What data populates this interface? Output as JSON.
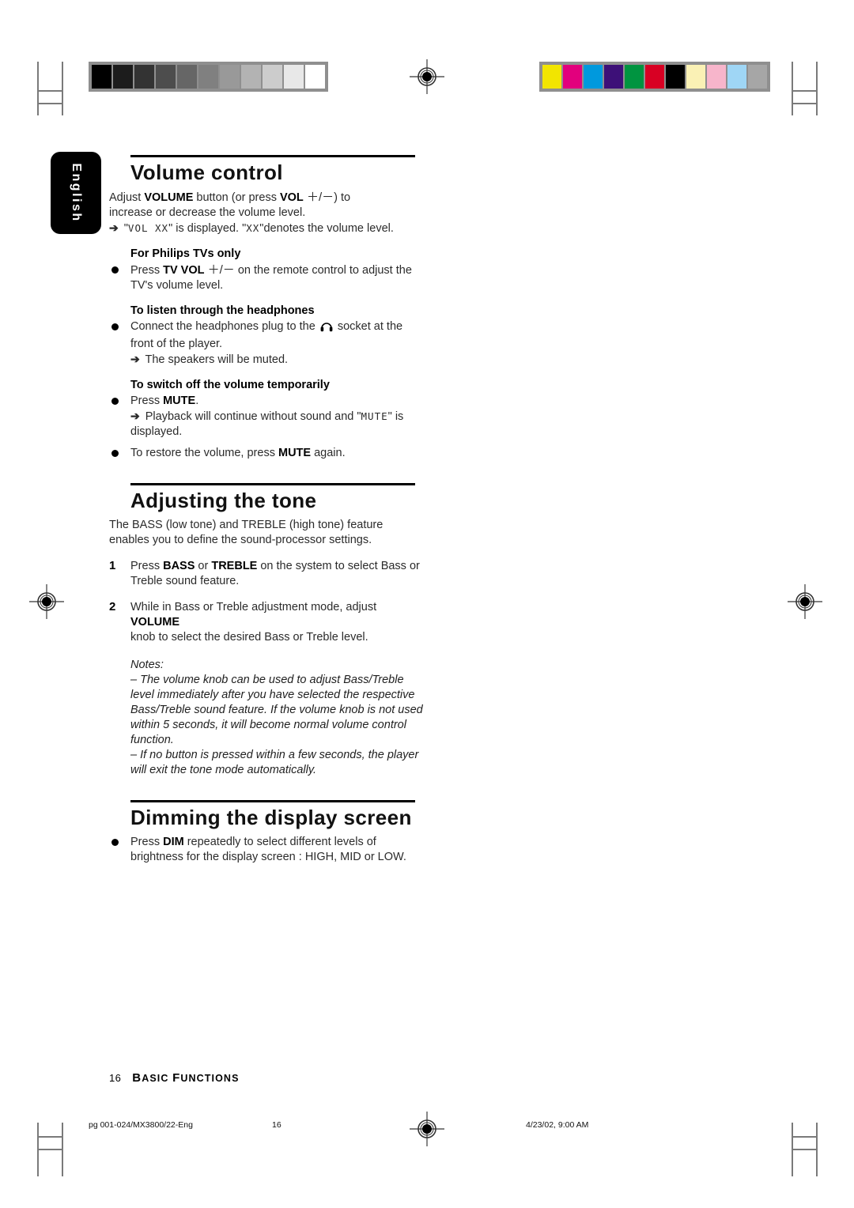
{
  "document": {
    "language_tab": "English",
    "page_number": "16",
    "chapter": "Basic Functions"
  },
  "print_marks": {
    "grayscale_steps": [
      "#000000",
      "#1c1c1c",
      "#333333",
      "#4d4d4d",
      "#666666",
      "#808080",
      "#999999",
      "#b3b3b3",
      "#cccccc",
      "#e8e8e8",
      "#ffffff"
    ],
    "color_steps": [
      "#f2e500",
      "#e2007d",
      "#0099dd",
      "#3d1078",
      "#009440",
      "#d80023",
      "#000000",
      "#faf1b5",
      "#f7b5cb",
      "#9fd6f5",
      "#a6a6a6"
    ],
    "registration_icon": "registration-target-icon"
  },
  "sections": [
    {
      "heading": "Volume control",
      "intro_line1_a": "Adjust ",
      "intro_line1_b": "VOLUME",
      "intro_line1_c": " button (or press ",
      "intro_line1_d": "VOL",
      "intro_line1_e": " ＋/－",
      "intro_line1_f": ") to",
      "intro_line2": "increase or decrease the volume level.",
      "display_arrow_pre": "\"",
      "display_lcd_1": "VOL  XX",
      "display_mid": "\" is displayed. \"",
      "display_lcd_2": "XX",
      "display_post": "\"denotes the volume level.",
      "sub1_title": "For Philips TVs only",
      "sub1_bullet_a": "Press ",
      "sub1_bullet_b": "TV VOL",
      "sub1_bullet_c": " ＋/－",
      "sub1_bullet_d": " on the remote control to adjust the",
      "sub1_bullet_line2": "TV's volume level.",
      "sub2_title": "To listen through the headphones",
      "sub2_bullet_a": "Connect the headphones plug to the ",
      "sub2_bullet_icon": "headphones-icon",
      "sub2_bullet_b": " socket at the",
      "sub2_bullet_line2": "front of the player.",
      "sub2_arrow": "The speakers will be muted.",
      "sub3_title": "To switch off the volume temporarily",
      "sub3_bullet_a": "Press ",
      "sub3_bullet_b": "MUTE",
      "sub3_bullet_c": ".",
      "sub3_arrow_a": "Playback will continue without sound and \"",
      "sub3_arrow_lcd": "MUTE",
      "sub3_arrow_b": "\" is",
      "sub3_arrow_line2": "displayed.",
      "sub3_bullet2_a": "To restore the volume, press ",
      "sub3_bullet2_b": "MUTE",
      "sub3_bullet2_c": " again."
    },
    {
      "heading": "Adjusting the tone",
      "intro_line1": "The BASS (low tone) and TREBLE (high tone) feature",
      "intro_line2": "enables you to define the sound-processor settings.",
      "step1_num": "1",
      "step1_a": "Press ",
      "step1_b": "BASS",
      "step1_c": " or ",
      "step1_d": "TREBLE",
      "step1_e": " on the system to select Bass or",
      "step1_line2": "Treble sound feature.",
      "step2_num": "2",
      "step2_a": "While in Bass or Treble adjustment mode, adjust ",
      "step2_b": "VOLUME",
      "step2_line2": "knob to select the desired Bass or Treble level.",
      "notes_title": "Notes:",
      "note1": "–  The volume knob can be used to adjust Bass/Treble level immediately after you have selected the respective Bass/Treble sound feature.  If the volume knob is not used within 5 seconds, it will become normal volume control function.",
      "note2": "–  If no button is pressed within a few seconds, the player will exit the tone mode automatically."
    },
    {
      "heading": "Dimming the display screen",
      "bullet_a": "Press ",
      "bullet_b": "DIM",
      "bullet_c": " repeatedly to select different levels of",
      "bullet_line2": "brightness for the display screen : HIGH, MID or LOW."
    }
  ],
  "print_line": {
    "file": "pg 001-024/MX3800/22-Eng",
    "page": "16",
    "timestamp": "4/23/02, 9:00 AM"
  }
}
